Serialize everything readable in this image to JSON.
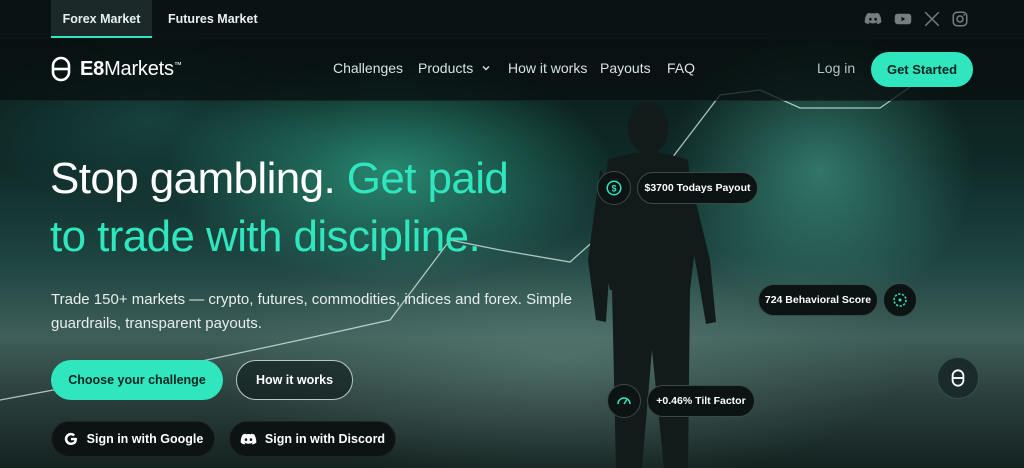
{
  "market_tabs": [
    {
      "label": "Forex Market",
      "active": true
    },
    {
      "label": "Futures Market",
      "active": false
    }
  ],
  "social_icons": [
    "discord-icon",
    "youtube-icon",
    "x-icon",
    "instagram-icon"
  ],
  "brand": {
    "name_bold": "E8",
    "name_rest": "Markets",
    "mark": "™"
  },
  "nav": {
    "links": [
      "Challenges",
      "Products",
      "How it works",
      "Payouts",
      "FAQ"
    ],
    "login": "Log in",
    "cta": "Get Started"
  },
  "hero": {
    "headline_white": "Stop gambling.",
    "headline_accent_1": "Get paid",
    "headline_accent_2": "to trade with discipline.",
    "description": "Trade 150+ markets — crypto, futures, commodities, indices and forex. Simple guardrails, transparent payouts.",
    "primary_cta": "Choose your challenge",
    "secondary_cta": "How it works",
    "google_signin": "Sign in with Google",
    "discord_signin": "Sign in with Discord"
  },
  "stats": {
    "payout": "$3700 Todays Payout",
    "score": "724 Behavioral Score",
    "tilt": "+0.46% Tilt Factor"
  },
  "colors": {
    "accent": "#2fe6be",
    "background": "#0b1a1a"
  }
}
